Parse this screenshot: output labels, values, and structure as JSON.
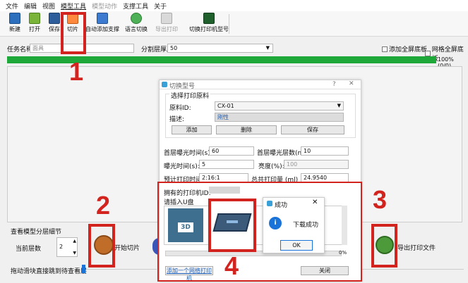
{
  "menu": {
    "items": [
      "文件",
      "编辑",
      "视图",
      "模型工具",
      "模型动作",
      "支撑工具",
      "关于"
    ]
  },
  "toolbar": {
    "new": "新建",
    "open": "打开",
    "save": "保存",
    "slice": "切片",
    "auto_support": "自动添加支撑",
    "language": "语言切换",
    "export_print": "导出打印",
    "switch_printer": "切换打印机型号"
  },
  "task": {
    "name_label": "任务名称",
    "name_value": "面具",
    "layer_thickness_label": "分割层厚度",
    "layer_thickness_value": "50",
    "add_full_bottom": "添加全屏底板",
    "mesh_full_bottom": "网格全屏底板"
  },
  "progress": {
    "percent": 100,
    "text": "100%",
    "count": "(0/0)"
  },
  "bottom": {
    "layer_section_title": "查看模型分层細节",
    "current_layer_label": "当前层数",
    "current_layer_value": "2",
    "start_slice": "开始切片",
    "export_print_file": "导出打印文件",
    "drag_hint": "拖动滑块直接跳到待查看层"
  },
  "dialog": {
    "title": "切换型号",
    "help": "?",
    "close": "✕",
    "group_title": "选择打印原料",
    "material_id_label": "原料ID:",
    "material_id_value": "CX-01",
    "description_label": "描述:",
    "description_value": "刚性",
    "add": "添加",
    "delete": "删除",
    "save": "保存",
    "first_exposure_label": "首层曝光时间(s):",
    "first_exposure_value": "60",
    "first_layers_label": "首层曝光层数(n):",
    "first_layers_value": "10",
    "exposure_label": "曝光时间(s):",
    "exposure_value": "5",
    "brightness_label": "亮度(%):",
    "brightness_value": "100",
    "est_time_label": "预计打印时间",
    "est_time_value": "2:16:1",
    "total_label": "总共打印量 (ml)",
    "total_value": "24.9540",
    "printer_id_label": "拥有的打印机ID:",
    "insert_label": "请插入U盘",
    "percent": "0%",
    "add_network_printer": "添加一个网络打印机",
    "close_btn": "关闭"
  },
  "success_popup": {
    "title": "成功",
    "message": "下载成功",
    "ok": "OK"
  },
  "callouts": [
    "1",
    "2",
    "3",
    "4"
  ],
  "colors": {
    "accent_red": "#d2231f",
    "progress_green": "#1fa83a",
    "info_blue": "#1a73d9"
  }
}
